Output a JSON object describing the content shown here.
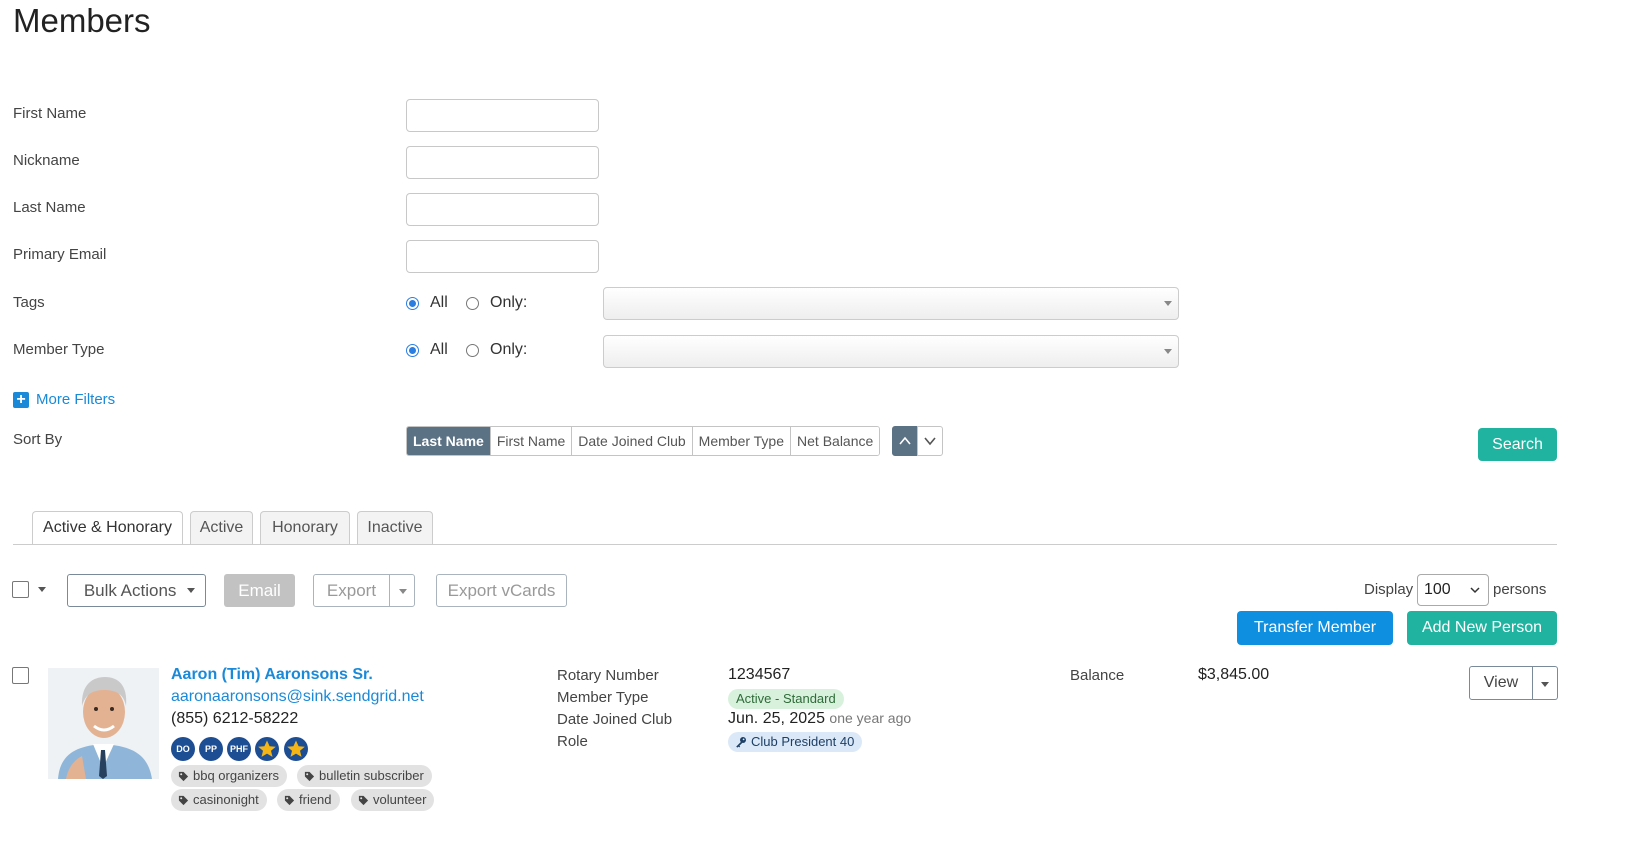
{
  "page": {
    "title": "Members"
  },
  "filters": {
    "first_name_label": "First Name",
    "nickname_label": "Nickname",
    "last_name_label": "Last Name",
    "primary_email_label": "Primary Email",
    "first_name_value": "",
    "nickname_value": "",
    "last_name_value": "",
    "primary_email_value": "",
    "tags_label": "Tags",
    "member_type_label": "Member Type",
    "all_label": "All",
    "only_label": "Only:",
    "tags_selection": "All",
    "member_type_selection": "All",
    "more_filters": "More Filters"
  },
  "sort": {
    "label": "Sort By",
    "options": [
      "Last Name",
      "First Name",
      "Date Joined Club",
      "Member Type",
      "Net Balance"
    ],
    "active": "Last Name",
    "direction": "ascending"
  },
  "search_button": "Search",
  "tabs": [
    "Active & Honorary",
    "Active",
    "Honorary",
    "Inactive"
  ],
  "active_tab": "Active & Honorary",
  "toolbar": {
    "bulk_actions": "Bulk Actions",
    "email": "Email",
    "export": "Export",
    "export_vcards": "Export vCards",
    "display_label": "Display",
    "display_value": "100",
    "persons_label": "persons",
    "transfer_member": "Transfer Member",
    "add_new_person": "Add New Person"
  },
  "colors": {
    "link": "#1a8ad8",
    "teal": "#20b3a0",
    "blue_button": "#0f8fe0",
    "sort_active": "#5b7184",
    "badge_navy": "#1d4e94"
  },
  "member": {
    "name": "Aaron (Tim) Aaronsons Sr.",
    "email": "aaronaaronsons@sink.sendgrid.net",
    "phone": "(855) 6212-58222",
    "badges": [
      "DO",
      "PP",
      "PHF"
    ],
    "star_badges": 2,
    "tags": [
      "bbq organizers",
      "bulletin subscriber",
      "casinonight",
      "friend",
      "volunteer"
    ],
    "rotary_number_label": "Rotary Number",
    "rotary_number": "1234567",
    "member_type_label": "Member Type",
    "member_type": "Active - Standard",
    "date_joined_label": "Date Joined Club",
    "date_joined": "Jun. 25, 2025",
    "date_joined_ago": "one year ago",
    "role_label": "Role",
    "role": "Club President 40",
    "balance_label": "Balance",
    "balance": "$3,845.00",
    "view_button": "View"
  }
}
